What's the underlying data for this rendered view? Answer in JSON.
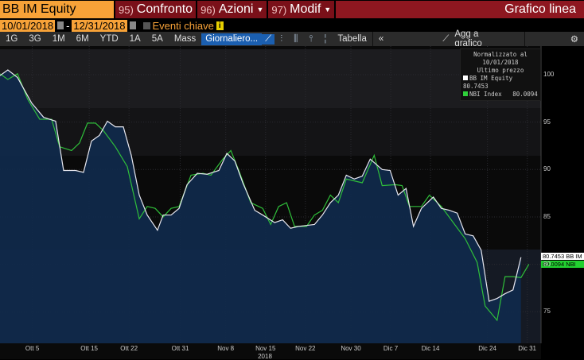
{
  "header": {
    "ticker": "BB IM Equity",
    "btn1_num": "95)",
    "btn1": "Confronto",
    "btn2_num": "96)",
    "btn2": "Azioni",
    "btn3_num": "97)",
    "btn3": "Modif",
    "title": "Grafico linea"
  },
  "range": {
    "start": "10/01/2018",
    "sep": "-",
    "end": "12/31/2018",
    "events": "Eventi chiave",
    "info": "i"
  },
  "toolbar": {
    "periods": [
      "1G",
      "3G",
      "1M",
      "6M",
      "YTD",
      "1A",
      "5A",
      "Mass"
    ],
    "frequency": "Giornaliero...",
    "table": "Tabella",
    "collapse": "«",
    "add": "Agg a grafico"
  },
  "legend": {
    "line1": "Normalizzato al 10/01/2018",
    "line2": "Ultimo prezzo",
    "s1": "BB IM Equity",
    "v1": "80.7453",
    "s2": "NBI Index",
    "v2": "80.0094"
  },
  "tags": {
    "t1": "80.7453 BB IM",
    "t2": "80.0094 NBI"
  },
  "chart_data": {
    "type": "line",
    "title": "Grafico linea",
    "xlabel": "2018",
    "x_unit": "days since 10/01/2018",
    "xlim": [
      -1.7,
      93
    ],
    "ylim": [
      72,
      104
    ],
    "yticks": [
      75,
      80,
      85,
      90,
      95,
      100
    ],
    "xticks": [
      {
        "day": 4,
        "label": "Ott 5"
      },
      {
        "day": 14,
        "label": "Ott 15"
      },
      {
        "day": 21,
        "label": "Ott 22"
      },
      {
        "day": 30,
        "label": "Ott 31"
      },
      {
        "day": 38,
        "label": "Nov 8"
      },
      {
        "day": 45,
        "label": "Nov 15"
      },
      {
        "day": 52,
        "label": "Nov 22"
      },
      {
        "day": 60,
        "label": "Nov 30"
      },
      {
        "day": 67,
        "label": "Dic 7"
      },
      {
        "day": 74,
        "label": "Dic 14"
      },
      {
        "day": 84,
        "label": "Dic 24"
      },
      {
        "day": 91,
        "label": "Dic 31"
      }
    ],
    "series": [
      {
        "name": "BB IM Equity",
        "color": "#e8e8f0",
        "points": [
          [
            -1.7,
            99.9
          ],
          [
            -0.3,
            100.5
          ],
          [
            1.4,
            99.7
          ],
          [
            3.9,
            97.0
          ],
          [
            6.0,
            95.5
          ],
          [
            8.1,
            95.1
          ],
          [
            9.5,
            89.9
          ],
          [
            11.6,
            89.9
          ],
          [
            13.0,
            89.7
          ],
          [
            14.4,
            93.0
          ],
          [
            15.8,
            93.6
          ],
          [
            17.2,
            95.1
          ],
          [
            18.6,
            94.5
          ],
          [
            20.0,
            94.5
          ],
          [
            21.4,
            91.5
          ],
          [
            22.8,
            87.3
          ],
          [
            24.2,
            85.2
          ],
          [
            26.0,
            83.6
          ],
          [
            27.0,
            85.2
          ],
          [
            28.4,
            85.2
          ],
          [
            29.8,
            85.9
          ],
          [
            31.2,
            88.4
          ],
          [
            33.0,
            89.6
          ],
          [
            34.7,
            89.5
          ],
          [
            36.8,
            89.9
          ],
          [
            38.2,
            91.7
          ],
          [
            39.6,
            90.9
          ],
          [
            41.0,
            88.6
          ],
          [
            43.1,
            85.7
          ],
          [
            44.5,
            85.2
          ],
          [
            46.6,
            84.4
          ],
          [
            48.0,
            84.7
          ],
          [
            49.4,
            83.8
          ],
          [
            50.8,
            84.0
          ],
          [
            53.6,
            84.2
          ],
          [
            55.0,
            85.2
          ],
          [
            56.4,
            86.5
          ],
          [
            57.8,
            87.3
          ],
          [
            59.2,
            89.4
          ],
          [
            60.6,
            89.0
          ],
          [
            62.0,
            89.3
          ],
          [
            63.4,
            91.1
          ],
          [
            65.5,
            90.0
          ],
          [
            66.9,
            89.9
          ],
          [
            68.3,
            87.3
          ],
          [
            69.7,
            88.0
          ],
          [
            71.0,
            84.0
          ],
          [
            72.4,
            85.9
          ],
          [
            74.5,
            87.1
          ],
          [
            75.9,
            85.9
          ],
          [
            77.3,
            85.7
          ],
          [
            78.7,
            85.4
          ],
          [
            80.1,
            83.2
          ],
          [
            81.5,
            83.0
          ],
          [
            82.9,
            81.5
          ],
          [
            84.3,
            76.1
          ],
          [
            85.7,
            76.4
          ],
          [
            87.1,
            76.9
          ],
          [
            88.5,
            77.3
          ],
          [
            89.9,
            80.7453
          ]
        ]
      },
      {
        "name": "NBI Index",
        "color": "#2fbf3a",
        "points": [
          [
            -1.7,
            100.1
          ],
          [
            -0.3,
            99.5
          ],
          [
            1.4,
            100.1
          ],
          [
            3.2,
            97.4
          ],
          [
            5.3,
            95.3
          ],
          [
            7.4,
            95.3
          ],
          [
            8.8,
            92.4
          ],
          [
            10.9,
            92.0
          ],
          [
            12.3,
            92.8
          ],
          [
            13.7,
            94.9
          ],
          [
            15.1,
            94.9
          ],
          [
            16.5,
            94.1
          ],
          [
            18.6,
            92.4
          ],
          [
            20.7,
            90.3
          ],
          [
            22.8,
            84.8
          ],
          [
            24.2,
            86.1
          ],
          [
            25.6,
            85.9
          ],
          [
            27.0,
            85.0
          ],
          [
            28.4,
            85.9
          ],
          [
            29.8,
            86.1
          ],
          [
            31.9,
            89.4
          ],
          [
            34.0,
            89.6
          ],
          [
            35.4,
            89.4
          ],
          [
            37.5,
            91.1
          ],
          [
            38.9,
            92.0
          ],
          [
            40.3,
            89.9
          ],
          [
            42.4,
            86.5
          ],
          [
            44.5,
            85.9
          ],
          [
            45.9,
            84.2
          ],
          [
            47.3,
            86.1
          ],
          [
            48.7,
            86.5
          ],
          [
            50.1,
            84.0
          ],
          [
            52.2,
            84.0
          ],
          [
            53.6,
            85.2
          ],
          [
            55.0,
            85.7
          ],
          [
            56.4,
            87.3
          ],
          [
            57.8,
            86.5
          ],
          [
            59.2,
            89.0
          ],
          [
            62.0,
            88.6
          ],
          [
            64.1,
            91.5
          ],
          [
            65.5,
            88.3
          ],
          [
            67.8,
            88.4
          ],
          [
            69.0,
            88.3
          ],
          [
            70.3,
            86.1
          ],
          [
            72.4,
            86.1
          ],
          [
            73.8,
            87.3
          ],
          [
            75.9,
            86.1
          ],
          [
            78.0,
            84.4
          ],
          [
            80.1,
            82.7
          ],
          [
            82.2,
            80.2
          ],
          [
            83.6,
            75.6
          ],
          [
            85.7,
            74.1
          ],
          [
            87.1,
            78.7
          ],
          [
            88.5,
            78.7
          ],
          [
            89.9,
            78.6
          ],
          [
            91.3,
            80.0094
          ]
        ]
      }
    ]
  }
}
